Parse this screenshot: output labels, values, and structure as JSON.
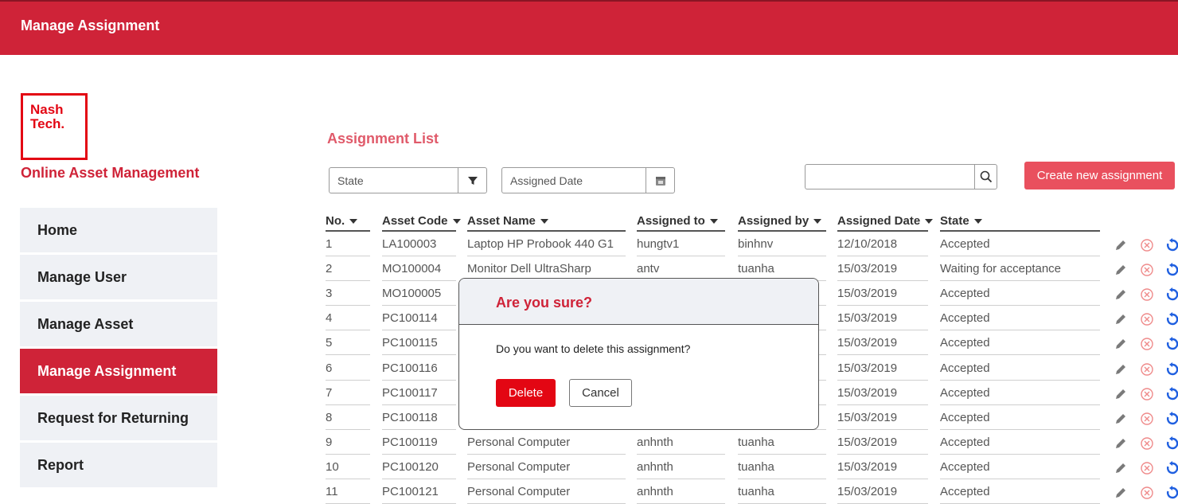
{
  "header": {
    "title": "Manage Assignment"
  },
  "logo": {
    "line1": "Nash",
    "line2": "Tech."
  },
  "app_title": "Online Asset Management",
  "nav": {
    "items": [
      {
        "label": "Home",
        "active": false
      },
      {
        "label": "Manage User",
        "active": false
      },
      {
        "label": "Manage Asset",
        "active": false
      },
      {
        "label": "Manage Assignment",
        "active": true
      },
      {
        "label": "Request for Returning",
        "active": false
      },
      {
        "label": "Report",
        "active": false
      }
    ]
  },
  "main": {
    "title": "Assignment List",
    "filters": {
      "state_label": "State",
      "date_label": "Assigned Date"
    },
    "search": {
      "value": "",
      "placeholder": ""
    },
    "create_label": "Create new assignment",
    "columns": [
      "No.",
      "Asset Code",
      "Asset Name",
      "Assigned to",
      "Assigned by",
      "Assigned Date",
      "State"
    ],
    "rows": [
      {
        "no": "1",
        "code": "LA100003",
        "name": "Laptop HP Probook 440 G1",
        "to": "hungtv1",
        "by": "binhnv",
        "date": "12/10/2018",
        "state": "Accepted"
      },
      {
        "no": "2",
        "code": "MO100004",
        "name": "Monitor Dell UltraSharp",
        "to": "antv",
        "by": "tuanha",
        "date": "15/03/2019",
        "state": "Waiting for acceptance"
      },
      {
        "no": "3",
        "code": "MO100005",
        "name": "",
        "to": "",
        "by": "",
        "date": "15/03/2019",
        "state": "Accepted"
      },
      {
        "no": "4",
        "code": "PC100114",
        "name": "",
        "to": "",
        "by": "",
        "date": "15/03/2019",
        "state": "Accepted"
      },
      {
        "no": "5",
        "code": "PC100115",
        "name": "",
        "to": "",
        "by": "",
        "date": "15/03/2019",
        "state": "Accepted"
      },
      {
        "no": "6",
        "code": "PC100116",
        "name": "",
        "to": "",
        "by": "",
        "date": "15/03/2019",
        "state": "Accepted"
      },
      {
        "no": "7",
        "code": "PC100117",
        "name": "",
        "to": "",
        "by": "",
        "date": "15/03/2019",
        "state": "Accepted"
      },
      {
        "no": "8",
        "code": "PC100118",
        "name": "",
        "to": "",
        "by": "",
        "date": "15/03/2019",
        "state": "Accepted"
      },
      {
        "no": "9",
        "code": "PC100119",
        "name": "Personal Computer",
        "to": "anhnth",
        "by": "tuanha",
        "date": "15/03/2019",
        "state": "Accepted"
      },
      {
        "no": "10",
        "code": "PC100120",
        "name": "Personal Computer",
        "to": "anhnth",
        "by": "tuanha",
        "date": "15/03/2019",
        "state": "Accepted"
      },
      {
        "no": "11",
        "code": "PC100121",
        "name": "Personal Computer",
        "to": "anhnth",
        "by": "tuanha",
        "date": "15/03/2019",
        "state": "Accepted"
      }
    ]
  },
  "modal": {
    "title": "Are you sure?",
    "message": "Do you want to delete this assignment?",
    "delete_label": "Delete",
    "cancel_label": "Cancel"
  },
  "colors": {
    "brand": "#cf2338",
    "accent": "#e9505e",
    "delete": "#e30613",
    "refresh": "#1f5fe0"
  },
  "icons": {
    "filter": "funnel-icon",
    "calendar": "calendar-icon",
    "search": "magnifier-icon",
    "edit": "pencil-icon",
    "delete": "x-circle-icon",
    "return": "refresh-icon"
  }
}
